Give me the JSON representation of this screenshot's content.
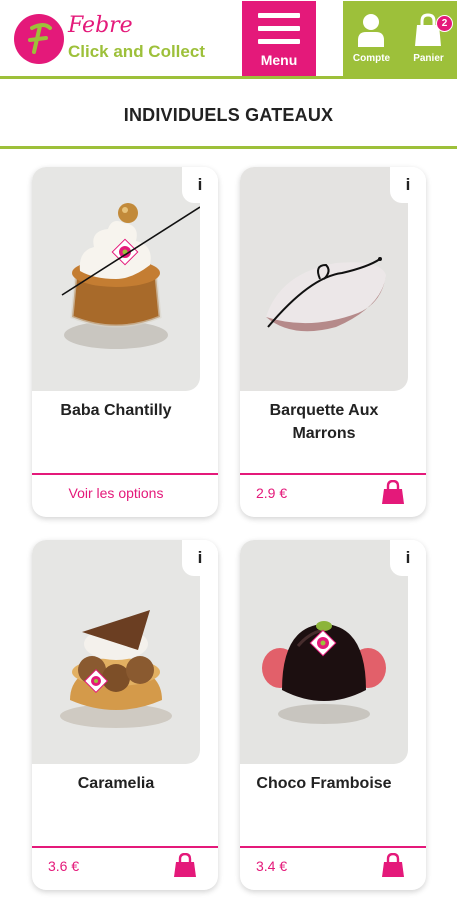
{
  "header": {
    "brand": "Febre",
    "tagline": "Click and Collect",
    "menu_label": "Menu",
    "account_label": "Compte",
    "cart_label": "Panier",
    "cart_count": "2"
  },
  "page": {
    "title": "INDIVIDUELS GATEAUX"
  },
  "products": [
    {
      "name": "Baba Chantilly",
      "footer": "Voir les options",
      "info": "i"
    },
    {
      "name": "Barquette Aux Marrons",
      "price": "2.9 €",
      "info": "i"
    },
    {
      "name": "Caramelia",
      "price": "3.6 €",
      "info": "i"
    },
    {
      "name": "Choco Framboise",
      "price": "3.4 €",
      "info": "i"
    }
  ],
  "colors": {
    "brand_pink": "#e4197a",
    "brand_green": "#9dc03a"
  },
  "icons": {
    "menu": "hamburger-icon",
    "account": "user-icon",
    "cart": "shopping-bag-icon",
    "add_to_cart": "shopping-bag-icon"
  }
}
